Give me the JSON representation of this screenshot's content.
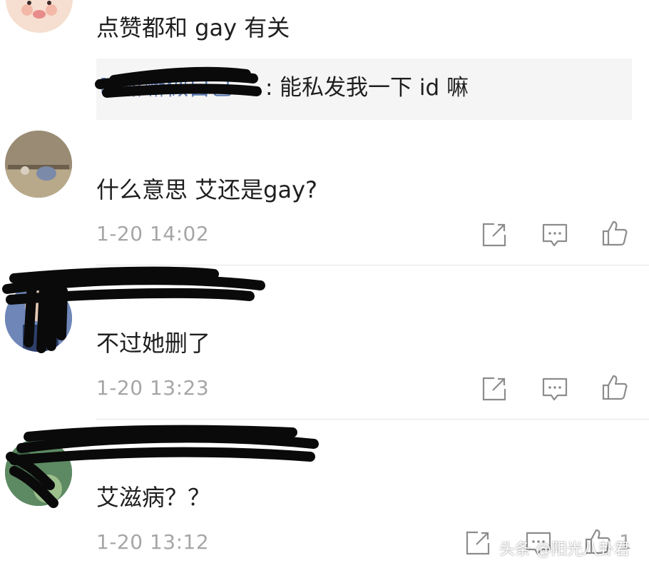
{
  "comments": [
    {
      "text": "点赞都和 gay 有关"
    },
    {
      "text": "什么意思 艾还是gay?",
      "time": "1-20 14:02"
    },
    {
      "text": "不过她删了",
      "time": "1-20 13:23"
    },
    {
      "text": "艾滋病？？",
      "time": "1-20 13:12",
      "like_count": "1"
    }
  ],
  "reply": {
    "username": "嘛嘛嘛做自己",
    "text": "能私发我一下 id 嘛"
  },
  "icons": {
    "share": "share-icon",
    "comment": "comment-icon",
    "like": "thumbs-up-icon"
  },
  "watermark": "头条 @阳光八卦君",
  "colors": {
    "text": "#1f1f1f",
    "meta": "#a6a6a6",
    "link": "#5a7bb5",
    "reply_bg": "#f5f5f5",
    "divider": "#e6e6e6"
  }
}
